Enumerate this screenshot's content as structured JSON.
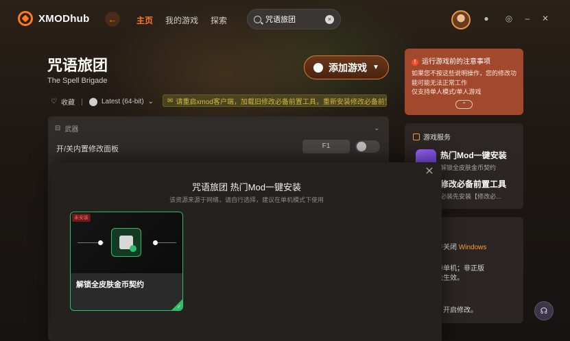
{
  "app": {
    "name": "XMODhub",
    "brand_color": "#ff7a1a"
  },
  "nav": {
    "back_icon": "arrow-left-icon",
    "items": [
      "主页",
      "我的游戏",
      "探索"
    ],
    "active": "主页"
  },
  "search": {
    "value": "咒语旅团",
    "placeholder": ""
  },
  "window_controls": [
    "settings-icon",
    "gear-icon",
    "minimize-icon",
    "close-icon"
  ],
  "game": {
    "title": "咒语旅团",
    "subtitle": "The Spell Brigade",
    "favorite_label": "收藏",
    "version_label": "Latest (64-bit)",
    "notice": "请重启xmod客户端，加载旧修改必备前置工具，重新安装修改必备前置",
    "add_button": "添加游戏"
  },
  "warning": {
    "title": "运行游戏前的注意事项",
    "line1": "如果您不按这些说明操作，您的修改功能可能无法正常工作",
    "line2": "仅支持单人模式/单人游戏"
  },
  "services": {
    "title": "游戏服务",
    "item1_name": "热门Mod一键安装",
    "item1_desc": "解锁全皮肤金币契约",
    "item2_name": "修改必备前置工具",
    "item2_desc": "必装先安装【修改必..."
  },
  "tips": {
    "line1": "软件并关闭",
    "line1_win": "Windows",
    "line2": "需保持单机；非正版",
    "line3": "法无法生效。",
    "line4": "改",
    "line5": "动后，开启修改。"
  },
  "panel": {
    "section": "武器",
    "row_label": "开/关内置修改面板",
    "hotkey": "F1"
  },
  "modal": {
    "title": "咒语旅团 热门Mod一键安装",
    "subtitle": "该资源来源于网络，请自行选择，建议在单机模式下使用",
    "card": {
      "badge": "未安装",
      "name": "解锁全皮肤金币契约"
    }
  }
}
